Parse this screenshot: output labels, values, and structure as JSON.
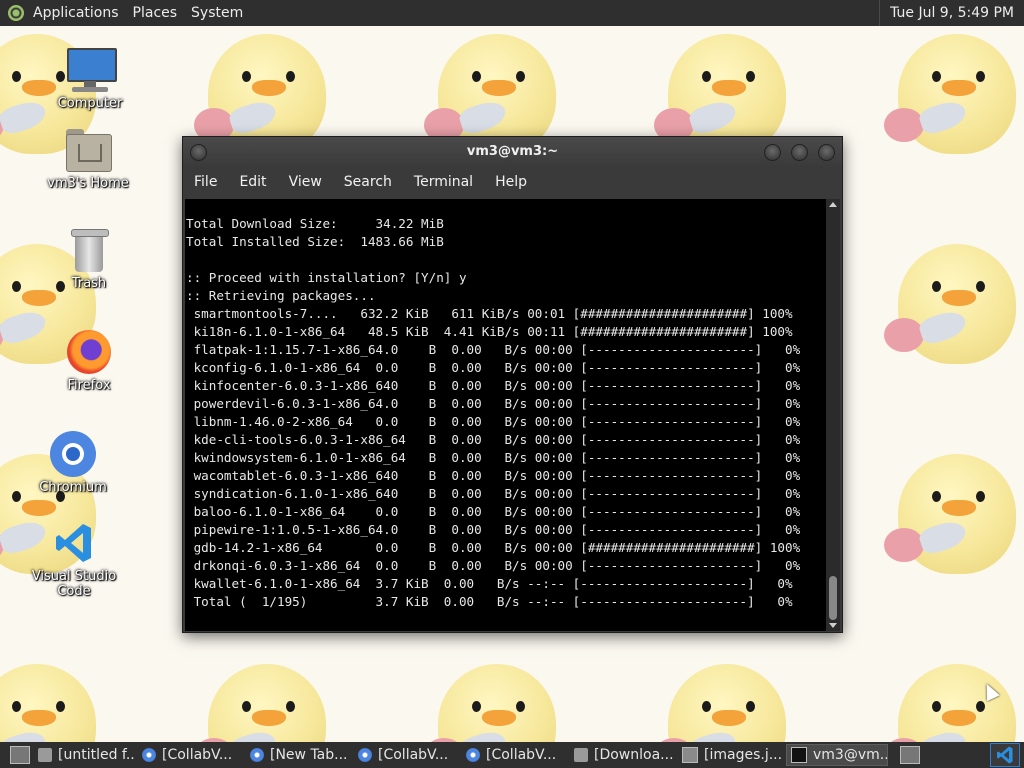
{
  "top_panel": {
    "menus": [
      "Applications",
      "Places",
      "System"
    ],
    "clock": "Tue Jul  9,  5:49 PM"
  },
  "desktop_icons": [
    {
      "label": "Computer",
      "icon": "computer-icon"
    },
    {
      "label": "vm3's Home",
      "icon": "home-folder-icon"
    },
    {
      "label": "Trash",
      "icon": "trash-icon"
    },
    {
      "label": "Firefox",
      "icon": "firefox-icon"
    },
    {
      "label": "Chromium",
      "icon": "chromium-icon"
    },
    {
      "label": "Visual Studio Code",
      "icon": "vscode-icon"
    }
  ],
  "terminal": {
    "title": "vm3@vm3:~",
    "menu": [
      "File",
      "Edit",
      "View",
      "Search",
      "Terminal",
      "Help"
    ],
    "lines": [
      "Total Download Size:     34.22 MiB",
      "Total Installed Size:  1483.66 MiB",
      "",
      ":: Proceed with installation? [Y/n] y",
      ":: Retrieving packages...",
      " smartmontools-7....   632.2 KiB   611 KiB/s 00:01 [######################] 100%",
      " ki18n-6.1.0-1-x86_64   48.5 KiB  4.41 KiB/s 00:11 [######################] 100%",
      " flatpak-1:1.15.7-1-x86_64.0    B  0.00   B/s 00:00 [----------------------]   0%",
      " kconfig-6.1.0-1-x86_64  0.0    B  0.00   B/s 00:00 [----------------------]   0%",
      " kinfocenter-6.0.3-1-x86_640    B  0.00   B/s 00:00 [----------------------]   0%",
      " powerdevil-6.0.3-1-x86_64.0    B  0.00   B/s 00:00 [----------------------]   0%",
      " libnm-1.46.0-2-x86_64   0.0    B  0.00   B/s 00:00 [----------------------]   0%",
      " kde-cli-tools-6.0.3-1-x86_64   B  0.00   B/s 00:00 [----------------------]   0%",
      " kwindowsystem-6.1.0-1-x86_64   B  0.00   B/s 00:00 [----------------------]   0%",
      " wacomtablet-6.0.3-1-x86_640    B  0.00   B/s 00:00 [----------------------]   0%",
      " syndication-6.1.0-1-x86_640    B  0.00   B/s 00:00 [----------------------]   0%",
      " baloo-6.1.0-1-x86_64    0.0    B  0.00   B/s 00:00 [----------------------]   0%",
      " pipewire-1:1.0.5-1-x86_64.0    B  0.00   B/s 00:00 [----------------------]   0%",
      " gdb-14.2-1-x86_64       0.0    B  0.00   B/s 00:00 [######################] 100%",
      " drkonqi-6.0.3-1-x86_64  0.0    B  0.00   B/s 00:00 [----------------------]   0%",
      " kwallet-6.1.0-1-x86_64  3.7 KiB  0.00   B/s --:-- [----------------------]   0%",
      " Total (  1/195)         3.7 KiB  0.00   B/s --:-- [----------------------]   0%"
    ]
  },
  "taskbar": {
    "tasks": [
      {
        "label": "[untitled f...",
        "icon": "folder-icon",
        "active": false
      },
      {
        "label": "[CollabV...",
        "icon": "chromium-icon",
        "active": false
      },
      {
        "label": "[New Tab...",
        "icon": "chromium-icon",
        "active": false
      },
      {
        "label": "[CollabV...",
        "icon": "chromium-icon",
        "active": false
      },
      {
        "label": "[CollabV...",
        "icon": "chromium-icon",
        "active": false
      },
      {
        "label": "[Downloa...",
        "icon": "folder-icon",
        "active": false
      },
      {
        "label": "[images.j...",
        "icon": "image-viewer-icon",
        "active": false
      },
      {
        "label": "vm3@vm...",
        "icon": "terminal-icon",
        "active": true
      }
    ]
  }
}
